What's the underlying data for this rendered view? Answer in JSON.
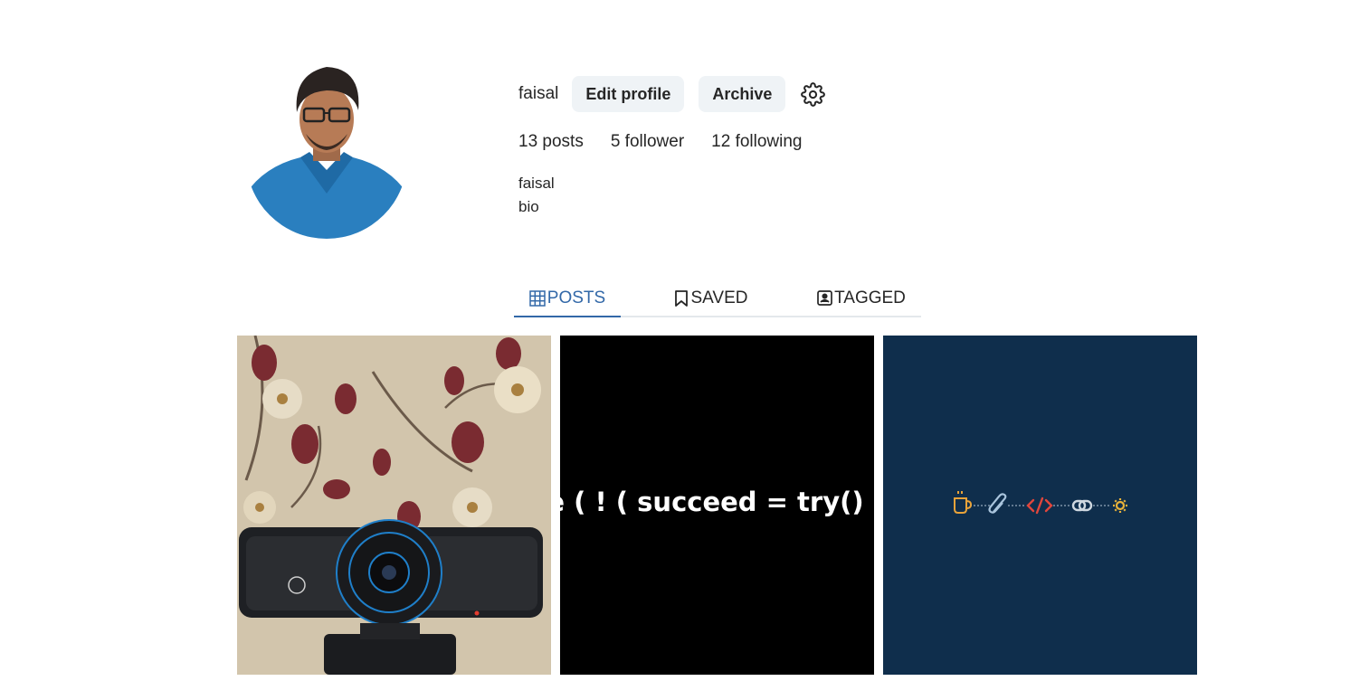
{
  "profile": {
    "username": "faisal",
    "edit_profile_label": "Edit profile",
    "archive_label": "Archive",
    "settings_icon": "gear-icon"
  },
  "stats": {
    "posts": "13 posts",
    "followers": "5 follower",
    "following": "12 following"
  },
  "bio": {
    "name": "faisal",
    "text": "bio"
  },
  "tabs": [
    {
      "label": "POSTS",
      "icon": "grid-icon",
      "active": true
    },
    {
      "label": "SAVED",
      "icon": "bookmark-icon",
      "active": false
    },
    {
      "label": "TAGGED",
      "icon": "tagged-user-icon",
      "active": false
    }
  ],
  "posts": [
    {
      "kind": "photo",
      "subject": "webcam"
    },
    {
      "kind": "text",
      "text": "e ( ! ( succeed = try()"
    },
    {
      "kind": "graphic",
      "icons": [
        "coffee-icon",
        "paperclip-icon",
        "code-icon",
        "link-icon",
        "gear-icon"
      ]
    }
  ],
  "colors": {
    "accent": "#3268a8",
    "button_bg": "#eff3f6",
    "navy_post_bg": "#0f2e4c"
  }
}
